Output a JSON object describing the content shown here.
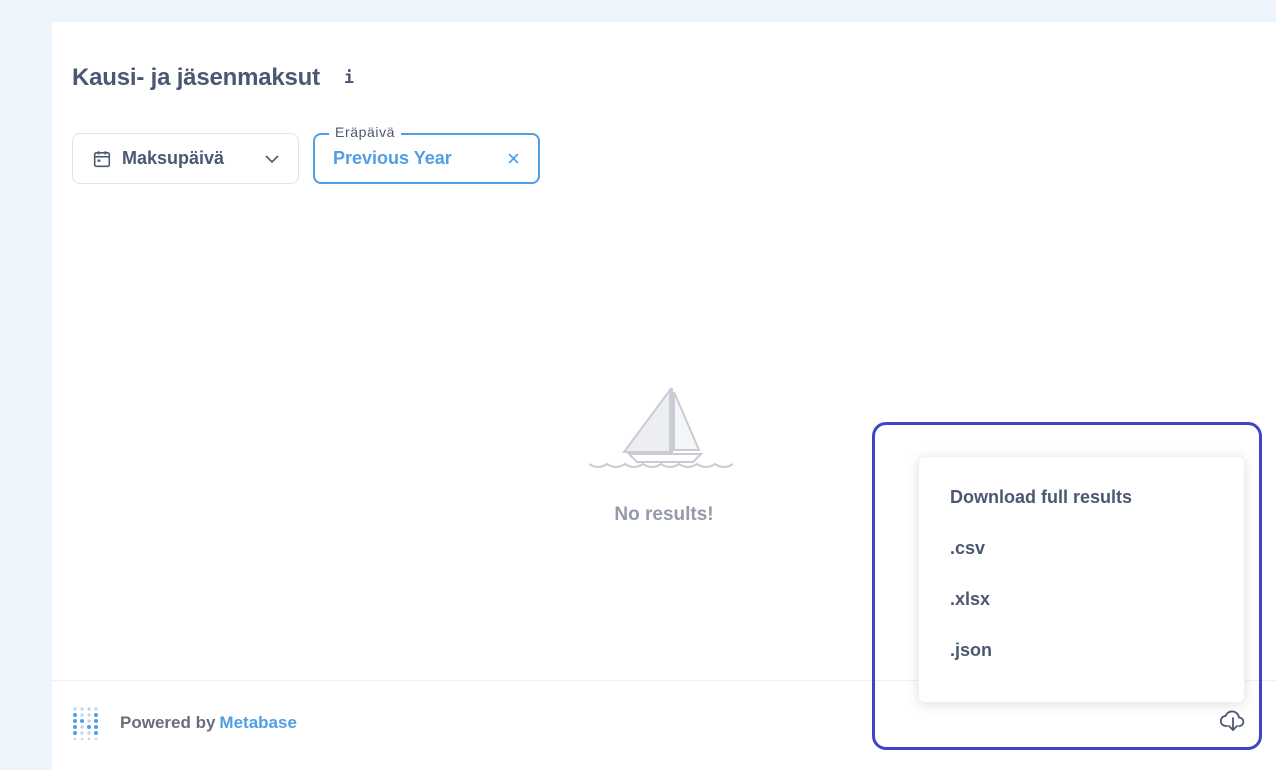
{
  "header": {
    "title": "Kausi- ja jäsenmaksut",
    "info_icon": "info-icon"
  },
  "filters": {
    "date": {
      "label": "Maksupäivä",
      "icon": "calendar-icon"
    },
    "due_date": {
      "legend": "Eräpäivä",
      "value": "Previous Year"
    }
  },
  "empty_state": {
    "message": "No results!"
  },
  "footer": {
    "powered_by": "Powered by",
    "brand": "Metabase"
  },
  "download_menu": {
    "title": "Download full results",
    "options": [
      ".csv",
      ".xlsx",
      ".json"
    ]
  },
  "colors": {
    "accent": "#509ee3",
    "text": "#4c5773",
    "highlight": "#3d46c9",
    "background": "#edf4fb"
  }
}
